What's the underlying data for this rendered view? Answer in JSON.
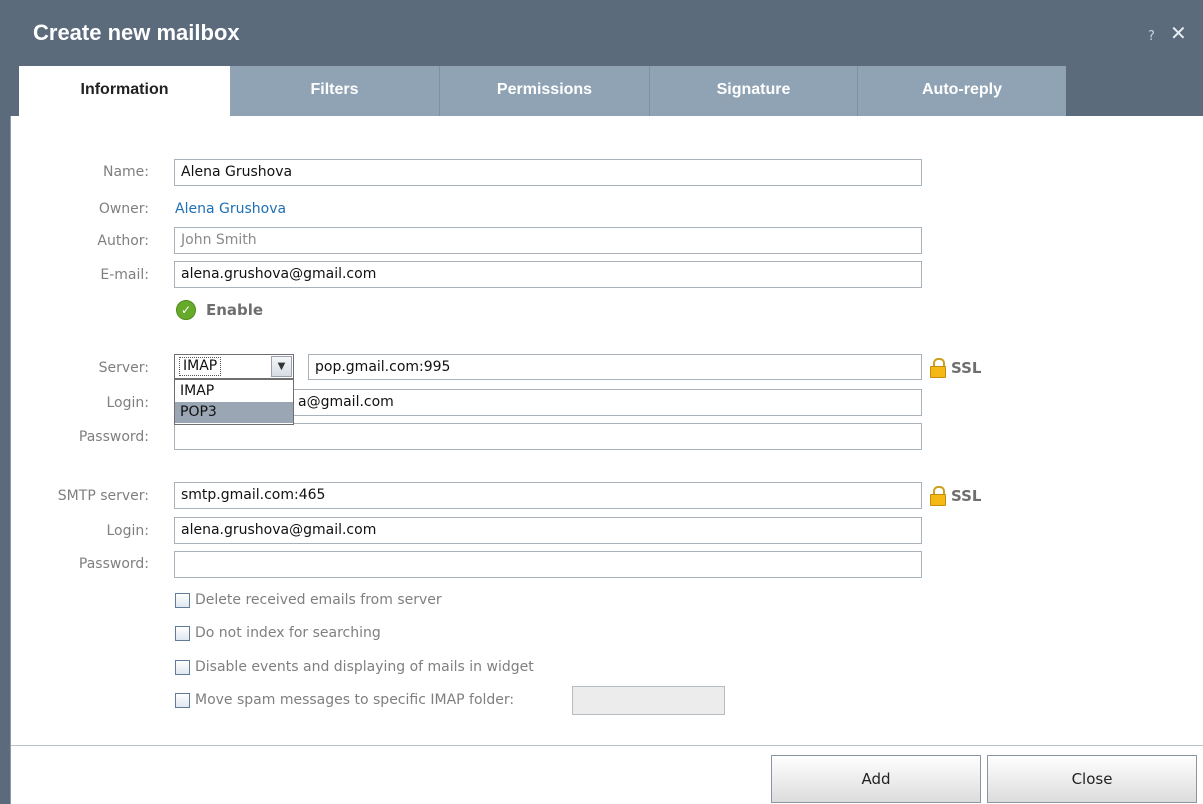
{
  "dialog": {
    "title": "Create new mailbox",
    "help_label": "?",
    "close_label": "✕"
  },
  "tabs": [
    {
      "label": "Information",
      "active": true
    },
    {
      "label": "Filters",
      "active": false
    },
    {
      "label": "Permissions",
      "active": false
    },
    {
      "label": "Signature",
      "active": false
    },
    {
      "label": "Auto-reply",
      "active": false
    }
  ],
  "info": {
    "name_label": "Name:",
    "name_value": "Alena Grushova",
    "owner_label": "Owner:",
    "owner_value": "Alena Grushova",
    "author_label": "Author:",
    "author_value": "John Smith",
    "email_label": "E-mail:",
    "email_value": "alena.grushova@gmail.com",
    "enable_label": "Enable"
  },
  "incoming": {
    "server_label": "Server:",
    "protocol_selected": "IMAP",
    "protocol_options": [
      "IMAP",
      "POP3"
    ],
    "protocol_highlighted": "POP3",
    "server_value": "pop.gmail.com:995",
    "ssl_label": "SSL",
    "login_label": "Login:",
    "login_visible_value": "a@gmail.com",
    "password_label": "Password:",
    "password_value": ""
  },
  "smtp": {
    "server_label": "SMTP server:",
    "server_value": "smtp.gmail.com:465",
    "ssl_label": "SSL",
    "login_label": "Login:",
    "login_value": "alena.grushova@gmail.com",
    "password_label": "Password:",
    "password_value": ""
  },
  "options": [
    {
      "label": "Delete received emails from server",
      "checked": false
    },
    {
      "label": "Do not index for searching",
      "checked": false
    },
    {
      "label": "Disable events and displaying of mails in widget",
      "checked": false
    },
    {
      "label": "Move spam messages to specific IMAP folder:",
      "checked": false
    }
  ],
  "spam_folder_value": "",
  "buttons": {
    "add": "Add",
    "close": "Close"
  },
  "colors": {
    "header_bg": "#5b6b7c",
    "tab_bg": "#8fa3b5",
    "link": "#1f6fb5",
    "enable_green": "#66aa2a",
    "lock_gold": "#f5b915"
  }
}
